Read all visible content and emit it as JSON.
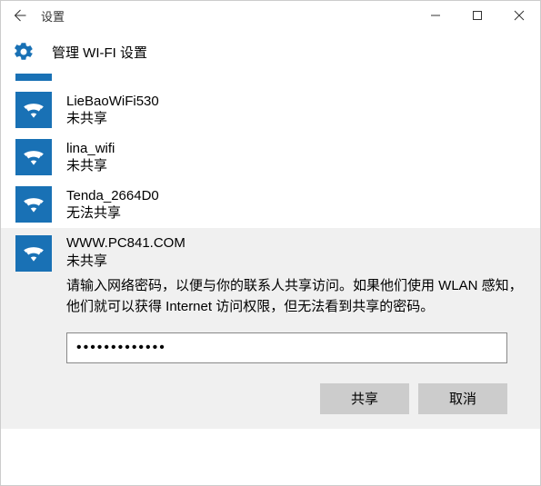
{
  "window": {
    "title": "设置"
  },
  "header": {
    "title": "管理 WI-FI 设置"
  },
  "networks": [
    {
      "name": "LieBaoWiFi530",
      "status": "未共享"
    },
    {
      "name": "lina_wifi",
      "status": "未共享"
    },
    {
      "name": "Tenda_2664D0",
      "status": "无法共享"
    }
  ],
  "selected": {
    "name": "WWW.PC841.COM",
    "status": "未共享",
    "description": "请输入网络密码，以便与你的联系人共享访问。如果他们使用 WLAN 感知，他们就可以获得 Internet 访问权限，但无法看到共享的密码。",
    "password": "•••••••••••••"
  },
  "buttons": {
    "share": "共享",
    "cancel": "取消"
  }
}
